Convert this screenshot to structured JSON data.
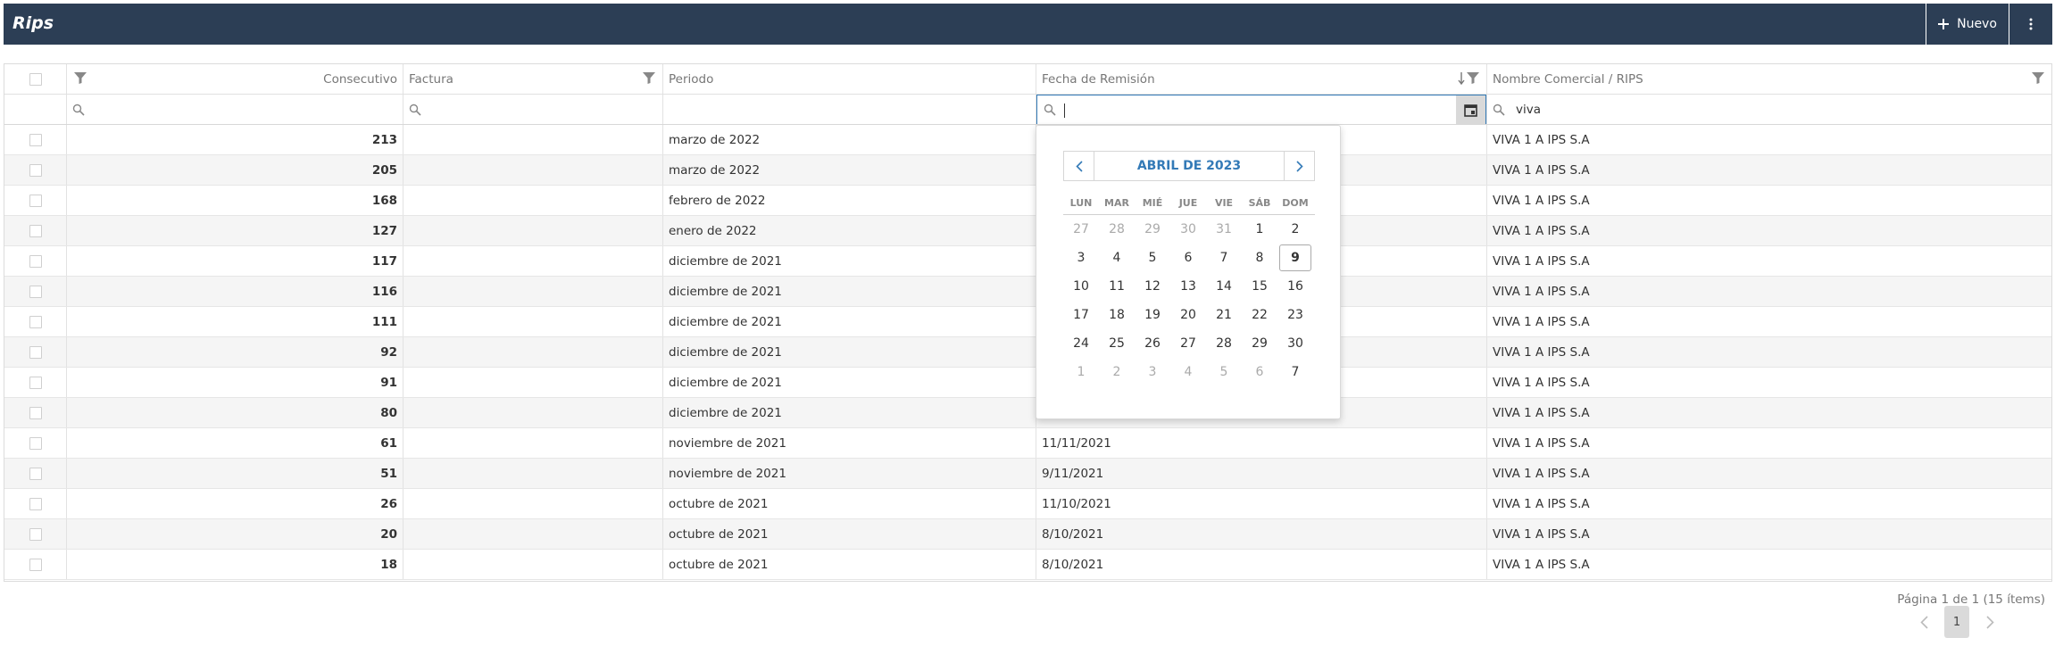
{
  "header": {
    "title": "Rips",
    "new_label": "Nuevo"
  },
  "columns": {
    "consecutivo": "Consecutivo",
    "factura": "Factura",
    "periodo": "Periodo",
    "fecha_remision": "Fecha de Remisión",
    "nombre": "Nombre Comercial / RIPS"
  },
  "filters": {
    "nombre_value": "viva",
    "fecha_value": ""
  },
  "rows": [
    {
      "consecutivo": "213",
      "factura": "",
      "periodo": "marzo de 2022",
      "fecha": "",
      "nombre": "VIVA 1 A IPS S.A"
    },
    {
      "consecutivo": "205",
      "factura": "",
      "periodo": "marzo de 2022",
      "fecha": "",
      "nombre": "VIVA 1 A IPS S.A"
    },
    {
      "consecutivo": "168",
      "factura": "",
      "periodo": "febrero de 2022",
      "fecha": "",
      "nombre": "VIVA 1 A IPS S.A"
    },
    {
      "consecutivo": "127",
      "factura": "",
      "periodo": "enero de 2022",
      "fecha": "",
      "nombre": "VIVA 1 A IPS S.A"
    },
    {
      "consecutivo": "117",
      "factura": "",
      "periodo": "diciembre de 2021",
      "fecha": "",
      "nombre": "VIVA 1 A IPS S.A"
    },
    {
      "consecutivo": "116",
      "factura": "",
      "periodo": "diciembre de 2021",
      "fecha": "",
      "nombre": "VIVA 1 A IPS S.A"
    },
    {
      "consecutivo": "111",
      "factura": "",
      "periodo": "diciembre de 2021",
      "fecha": "",
      "nombre": "VIVA 1 A IPS S.A"
    },
    {
      "consecutivo": "92",
      "factura": "",
      "periodo": "diciembre de 2021",
      "fecha": "",
      "nombre": "VIVA 1 A IPS S.A"
    },
    {
      "consecutivo": "91",
      "factura": "",
      "periodo": "diciembre de 2021",
      "fecha": "",
      "nombre": "VIVA 1 A IPS S.A"
    },
    {
      "consecutivo": "80",
      "factura": "",
      "periodo": "diciembre de 2021",
      "fecha": "",
      "nombre": "VIVA 1 A IPS S.A"
    },
    {
      "consecutivo": "61",
      "factura": "",
      "periodo": "noviembre de 2021",
      "fecha": "11/11/2021",
      "nombre": "VIVA 1 A IPS S.A"
    },
    {
      "consecutivo": "51",
      "factura": "",
      "periodo": "noviembre de 2021",
      "fecha": "9/11/2021",
      "nombre": "VIVA 1 A IPS S.A"
    },
    {
      "consecutivo": "26",
      "factura": "",
      "periodo": "octubre de 2021",
      "fecha": "11/10/2021",
      "nombre": "VIVA 1 A IPS S.A"
    },
    {
      "consecutivo": "20",
      "factura": "",
      "periodo": "octubre de 2021",
      "fecha": "8/10/2021",
      "nombre": "VIVA 1 A IPS S.A"
    },
    {
      "consecutivo": "18",
      "factura": "",
      "periodo": "octubre de 2021",
      "fecha": "8/10/2021",
      "nombre": "VIVA 1 A IPS S.A"
    }
  ],
  "calendar": {
    "month_label": "ABRIL DE 2023",
    "weekdays": [
      "LUN",
      "MAR",
      "MIÉ",
      "JUE",
      "VIE",
      "SÁB",
      "DOM"
    ],
    "weeks": [
      [
        "27",
        "28",
        "29",
        "30",
        "31",
        "1",
        "2"
      ],
      [
        "3",
        "4",
        "5",
        "6",
        "7",
        "8",
        "9"
      ],
      [
        "10",
        "11",
        "12",
        "13",
        "14",
        "15",
        "16"
      ],
      [
        "17",
        "18",
        "19",
        "20",
        "21",
        "22",
        "23"
      ],
      [
        "24",
        "25",
        "26",
        "27",
        "28",
        "29",
        "30"
      ],
      [
        "1",
        "2",
        "3",
        "4",
        "5",
        "6",
        "7"
      ]
    ],
    "today": "9"
  },
  "pager": {
    "info": "Página 1 de 1 (15 ítems)",
    "current_page": "1"
  },
  "colors": {
    "header_bg": "#2c3e55",
    "accent": "#337ab7"
  }
}
